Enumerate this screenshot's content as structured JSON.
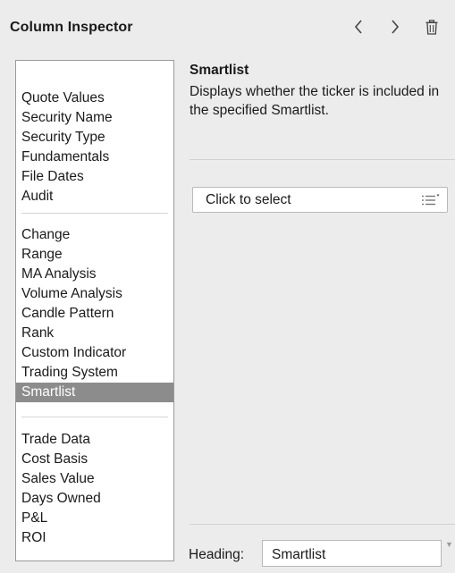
{
  "header": {
    "title": "Column Inspector"
  },
  "sidebar": {
    "groups": [
      [
        "Quote Values",
        "Security Name",
        "Security Type",
        "Fundamentals",
        "File Dates",
        "Audit"
      ],
      [
        "Change",
        "Range",
        "MA Analysis",
        "Volume Analysis",
        "Candle Pattern",
        "Rank",
        "Custom Indicator",
        "Trading System",
        "Smartlist"
      ],
      [
        "Trade Data",
        "Cost Basis",
        "Sales Value",
        "Days Owned",
        "P&L",
        "ROI"
      ]
    ],
    "selected": "Smartlist"
  },
  "detail": {
    "title": "Smartlist",
    "description": "Displays whether the ticker is included in the specified Smartlist.",
    "select_label": "Click to select",
    "heading_label": "Heading:",
    "heading_value": "Smartlist"
  },
  "icons": {
    "back": "chevron-left-icon",
    "forward": "chevron-right-icon",
    "delete": "trash-icon",
    "list": "list-options-icon"
  }
}
